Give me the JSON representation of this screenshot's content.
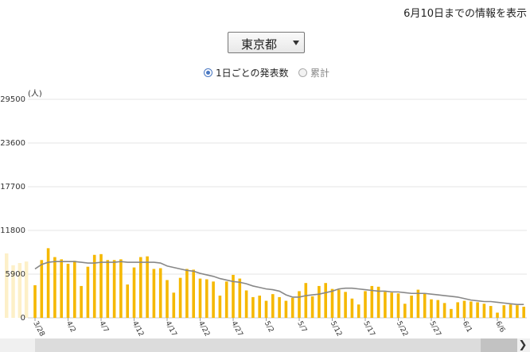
{
  "header": {
    "note": "6月10日までの情報を表示"
  },
  "prefecture_select": {
    "selected": "東京都"
  },
  "view_toggle": {
    "daily_label": "1日ごとの発表数",
    "cumulative_label": "累計",
    "selected": "daily"
  },
  "chart_data": {
    "type": "bar",
    "unit_label": "(人)",
    "y_ticks": [
      0,
      5900,
      11800,
      17700,
      23600,
      29500
    ],
    "ylim": [
      0,
      29500
    ],
    "x_tick_labels": [
      "3/28",
      "4/2",
      "4/7",
      "4/12",
      "4/17",
      "4/22",
      "4/27",
      "5/2",
      "5/7",
      "5/12",
      "5/17",
      "5/22",
      "5/27",
      "6/1",
      "6/6"
    ],
    "categories": [
      "3/28",
      "3/29",
      "3/30",
      "3/31",
      "4/1",
      "4/2",
      "4/3",
      "4/4",
      "4/5",
      "4/6",
      "4/7",
      "4/8",
      "4/9",
      "4/10",
      "4/11",
      "4/12",
      "4/13",
      "4/14",
      "4/15",
      "4/16",
      "4/17",
      "4/18",
      "4/19",
      "4/20",
      "4/21",
      "4/22",
      "4/23",
      "4/24",
      "4/25",
      "4/26",
      "4/27",
      "4/28",
      "4/29",
      "4/30",
      "5/1",
      "5/2",
      "5/3",
      "5/4",
      "5/5",
      "5/6",
      "5/7",
      "5/8",
      "5/9",
      "5/10",
      "5/11",
      "5/12",
      "5/13",
      "5/14",
      "5/15",
      "5/16",
      "5/17",
      "5/18",
      "5/19",
      "5/20",
      "5/21",
      "5/22",
      "5/23",
      "5/24",
      "5/25",
      "5/26",
      "5/27",
      "5/28",
      "5/29",
      "5/30",
      "5/31",
      "6/1",
      "6/2",
      "6/3",
      "6/4",
      "6/5",
      "6/6",
      "6/7",
      "6/8",
      "6/9",
      "6/10"
    ],
    "series": [
      {
        "type": "bar",
        "color": "#f5b800",
        "values": [
          4400,
          7800,
          9400,
          8200,
          7900,
          7300,
          7700,
          4300,
          6900,
          8500,
          8600,
          7800,
          7800,
          7900,
          4500,
          6800,
          8200,
          8300,
          6600,
          6700,
          5100,
          3400,
          5400,
          6600,
          6500,
          5300,
          5200,
          4900,
          3000,
          4900,
          5800,
          5300,
          3700,
          2800,
          3000,
          2300,
          3200,
          2800,
          2300,
          2700,
          3600,
          4700,
          2900,
          4300,
          4700,
          3900,
          3800,
          3500,
          2600,
          1800,
          3600,
          4300,
          4200,
          3500,
          3400,
          3300,
          1900,
          3000,
          3800,
          3300,
          2500,
          2400,
          2000,
          1200,
          2100,
          2300,
          2200,
          2100,
          1900,
          1600,
          700,
          1700,
          1800,
          1700,
          1500
        ]
      },
      {
        "type": "line",
        "color": "#888888",
        "values": [
          6600,
          7200,
          7500,
          7600,
          7600,
          7600,
          7600,
          7500,
          7400,
          7400,
          7500,
          7500,
          7500,
          7600,
          7500,
          7500,
          7500,
          7500,
          7500,
          7400,
          7000,
          6800,
          6600,
          6400,
          6300,
          6000,
          5800,
          5600,
          5300,
          5100,
          4900,
          4800,
          4600,
          4300,
          4100,
          3900,
          3800,
          3600,
          3100,
          2800,
          2800,
          3000,
          3100,
          3200,
          3400,
          3600,
          3900,
          4000,
          4000,
          3900,
          3800,
          3700,
          3600,
          3600,
          3500,
          3500,
          3400,
          3300,
          3300,
          3300,
          3200,
          3100,
          3000,
          2900,
          2800,
          2600,
          2400,
          2300,
          2200,
          2200,
          2100,
          2000,
          1900,
          1800,
          1800
        ]
      }
    ],
    "faded_bars": {
      "color": "#fdf0c8",
      "values": [
        8700,
        7100,
        7400,
        7600
      ]
    },
    "grid": true,
    "legend": false
  }
}
